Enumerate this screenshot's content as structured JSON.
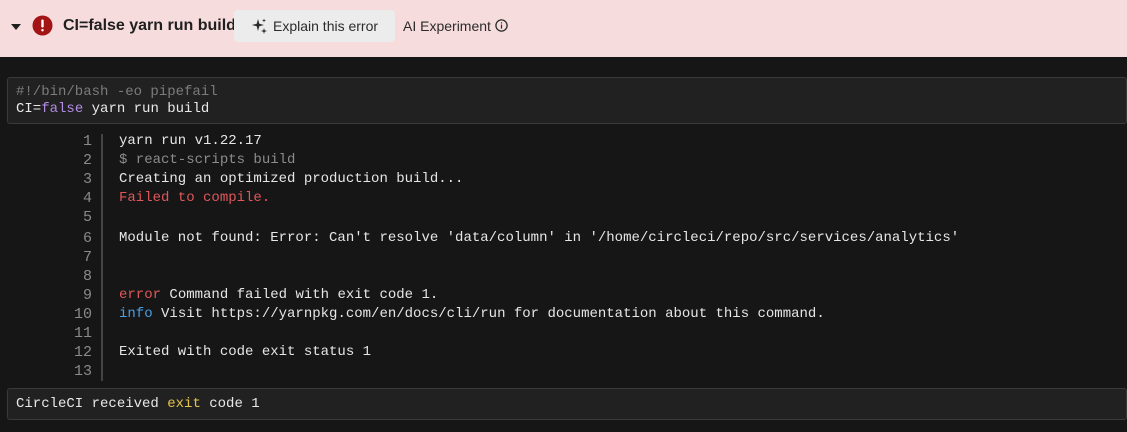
{
  "header": {
    "title": "CI=false yarn run build",
    "explain_label": "Explain this error",
    "ai_label": "AI Experiment",
    "icons": {
      "collapse": "chevron-down-icon",
      "error": "error-circle-icon",
      "sparkle": "sparkle-icon",
      "info": "info-icon"
    },
    "colors": {
      "banner_bg": "#f6dcdc",
      "error_red": "#a31515"
    }
  },
  "command": {
    "shebang": "#!/bin/bash -eo pipefail",
    "cmd_prefix": "CI=",
    "cmd_keyword": "false",
    "cmd_suffix": " yarn run build"
  },
  "output": {
    "lines": [
      {
        "n": "1",
        "text": "yarn run v1.22.17"
      },
      {
        "n": "2",
        "text": "$ react-scripts build"
      },
      {
        "n": "3",
        "text": "Creating an optimized production build..."
      },
      {
        "n": "4",
        "text": "Failed to compile."
      },
      {
        "n": "5",
        "text": ""
      },
      {
        "n": "6",
        "text": "Module not found: Error: Can't resolve 'data/column' in '/home/circleci/repo/src/services/analytics'"
      },
      {
        "n": "7",
        "text": ""
      },
      {
        "n": "8",
        "text": ""
      },
      {
        "n": "9",
        "tag": "error",
        "text": " Command failed with exit code 1."
      },
      {
        "n": "10",
        "tag": "info",
        "text": " Visit https://yarnpkg.com/en/docs/cli/run for documentation about this command."
      },
      {
        "n": "11",
        "text": ""
      },
      {
        "n": "12",
        "text": "Exited with code exit status 1"
      },
      {
        "n": "13",
        "text": ""
      }
    ]
  },
  "footer": {
    "prefix": "CircleCI received ",
    "keyword": "exit",
    "suffix": " code 1"
  }
}
